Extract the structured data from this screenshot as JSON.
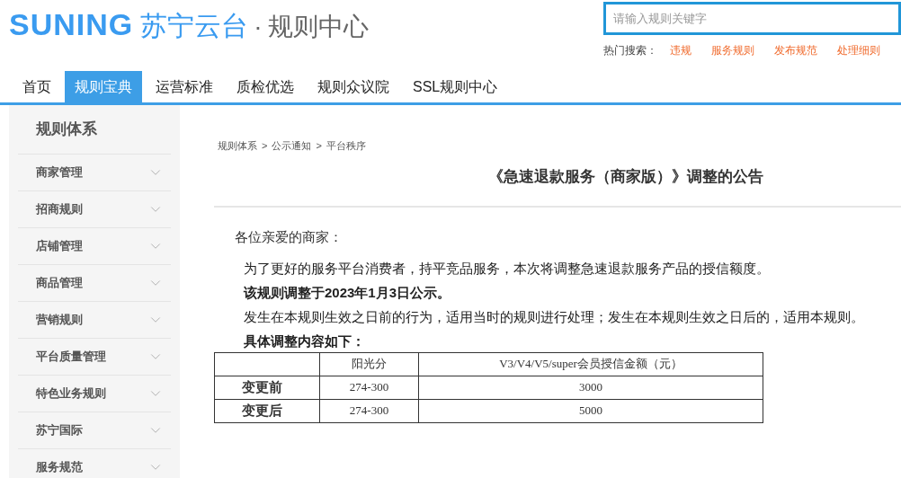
{
  "logo": {
    "brand": "SUNING",
    "brand_cn": "苏宁云台",
    "separator": "·",
    "subtitle": "规则中心"
  },
  "search": {
    "placeholder": "请输入规则关键字"
  },
  "hot_search": {
    "label": "热门搜索：",
    "links": [
      "违规",
      "服务规则",
      "发布规范",
      "处理细则"
    ]
  },
  "nav_tabs": [
    {
      "label": "首页",
      "selected": false
    },
    {
      "label": "规则宝典",
      "selected": true
    },
    {
      "label": "运营标准",
      "selected": false
    },
    {
      "label": "质检优选",
      "selected": false
    },
    {
      "label": "规则众议院",
      "selected": false
    },
    {
      "label": "SSL规则中心",
      "selected": false
    }
  ],
  "sidebar": {
    "title": "规则体系",
    "items": [
      "商家管理",
      "招商规则",
      "店铺管理",
      "商品管理",
      "营销规则",
      "平台质量管理",
      "特色业务规则",
      "苏宁国际",
      "服务规范"
    ]
  },
  "breadcrumb": [
    "规则体系",
    "公示通知",
    "平台秩序"
  ],
  "breadcrumb_separator": ">",
  "article": {
    "title": "《急速退款服务（商家版）》调整的公告",
    "greeting": "各位亲爱的商家：",
    "paragraphs": [
      {
        "text": "为了更好的服务平台消费者，持平竞品服务，本次将调整急速退款服务产品的授信额度。",
        "bold": false
      },
      {
        "text": "该规则调整于2023年1月3日公示。",
        "bold": true
      },
      {
        "text": "发生在本规则生效之日前的行为，适用当时的规则进行处理；发生在本规则生效之日后的，适用本规则。",
        "bold": false
      },
      {
        "text": "具体调整内容如下：",
        "bold": true
      }
    ],
    "table": {
      "columns": [
        "阳光分",
        "V3/V4/V5/super会员授信金额（元）"
      ],
      "rows": [
        {
          "label": "变更前",
          "cells": [
            "274-300",
            "3000"
          ]
        },
        {
          "label": "变更后",
          "cells": [
            "274-300",
            "5000"
          ]
        }
      ]
    }
  }
}
